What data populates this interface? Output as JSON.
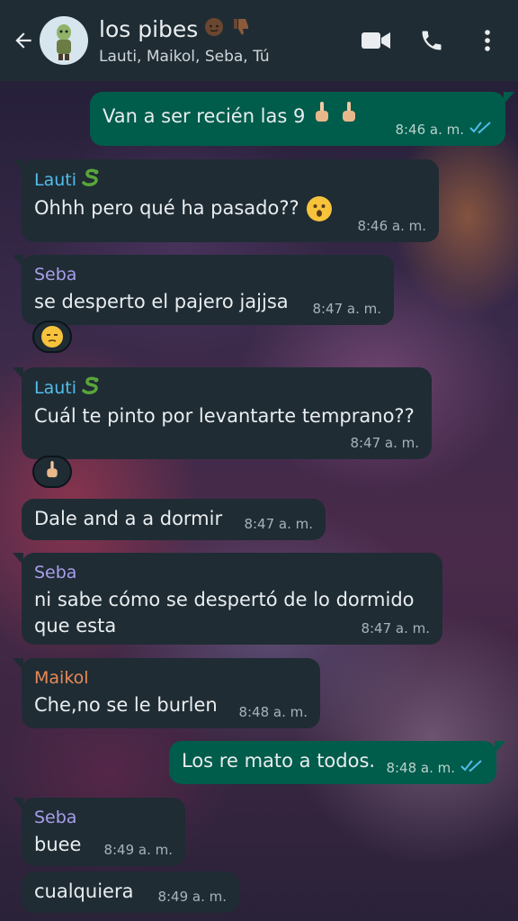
{
  "header": {
    "title": "los pibes",
    "subtitle": "Lauti, Maikol, Seba, Tú",
    "title_emojis": [
      "dark-skin-person-emoji",
      "thumbs-down-emoji"
    ]
  },
  "colors": {
    "header_bg": "#1f2c34",
    "incoming_bubble": "#1f2c34",
    "outgoing_bubble": "#005c4b",
    "lauti": "#53bdeb",
    "seba": "#a99ee9",
    "maikol": "#e98a58",
    "read_ticks": "#53bdeb"
  },
  "messages": [
    {
      "dir": "out",
      "text": "Van a ser recién las 9",
      "time": "8:46 a. m.",
      "emoji": "middle-finger x2",
      "ticks": "read"
    },
    {
      "dir": "in",
      "sender": "Lauti",
      "text": "Ohhh pero qué ha pasado??",
      "time": "8:46 a. m.",
      "emoji": "surprised-face"
    },
    {
      "dir": "in",
      "sender": "Seba",
      "text": "se desperto el pajero jajjsa",
      "time": "8:47 a. m.",
      "reaction": "unamused-face"
    },
    {
      "dir": "in",
      "sender": "Lauti",
      "text": "Cuál te pinto por levantarte temprano??",
      "time": "8:47 a. m.",
      "reaction": "middle-finger"
    },
    {
      "dir": "in",
      "text": "Dale and a a dormir",
      "time": "8:47 a. m."
    },
    {
      "dir": "in",
      "sender": "Seba",
      "text": "ni sabe cómo se despertó de lo dormido que esta",
      "time": "8:47 a. m."
    },
    {
      "dir": "in",
      "sender": "Maikol",
      "text": "Che,no se le burlen",
      "time": "8:48 a. m."
    },
    {
      "dir": "out",
      "text": "Los re mato a todos.",
      "time": "8:48 a. m.",
      "ticks": "read"
    },
    {
      "dir": "in",
      "sender": "Seba",
      "text": "buee",
      "time": "8:49 a. m."
    },
    {
      "dir": "in",
      "text": "cualquiera",
      "time": "8:49 a. m."
    }
  ]
}
